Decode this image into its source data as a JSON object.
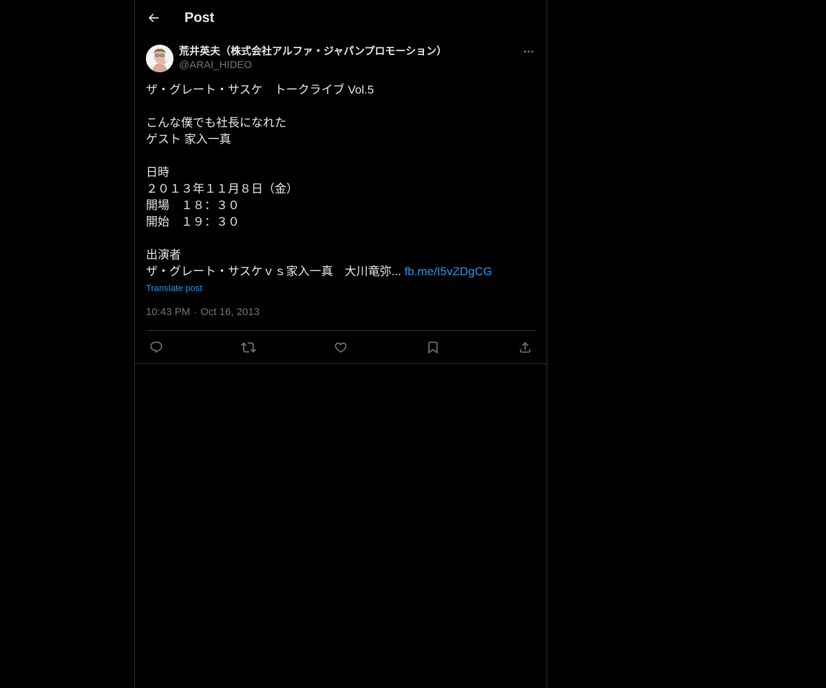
{
  "header": {
    "title": "Post",
    "back_icon": "arrow-left-icon"
  },
  "post": {
    "author_name": "荒井英夫（株式会社アルファ・ジャパンプロモーション）",
    "author_handle": "@ARAI_HIDEO",
    "avatar_icon": "avatar",
    "more_icon": "more-horizontal-icon",
    "text_lines": [
      "ザ・グレート・サスケ　トークライブ Vol.5",
      "",
      "こんな僕でも社長になれた",
      "ゲスト 家入一真",
      "",
      "日時",
      "２０１３年１１月８日（金）",
      "開場　１８：３０",
      "開始　１９：３０",
      "",
      "出演者"
    ],
    "last_line_text": "ザ・グレート・サスケｖｓ家入一真　大川竜弥... ",
    "link_text": "fb.me/I5vZDgCG",
    "translate_label": "Translate post",
    "time": "10:43 PM",
    "separator": "·",
    "date": "Oct 16, 2013"
  },
  "actions": {
    "reply_icon": "reply-icon",
    "repost_icon": "repost-icon",
    "like_icon": "heart-icon",
    "bookmark_icon": "bookmark-icon",
    "share_icon": "share-icon"
  },
  "colors": {
    "background": "#000000",
    "border": "#2f3336",
    "text_primary": "#e7e9ea",
    "text_secondary": "#71767b",
    "link": "#1d9bf0"
  }
}
